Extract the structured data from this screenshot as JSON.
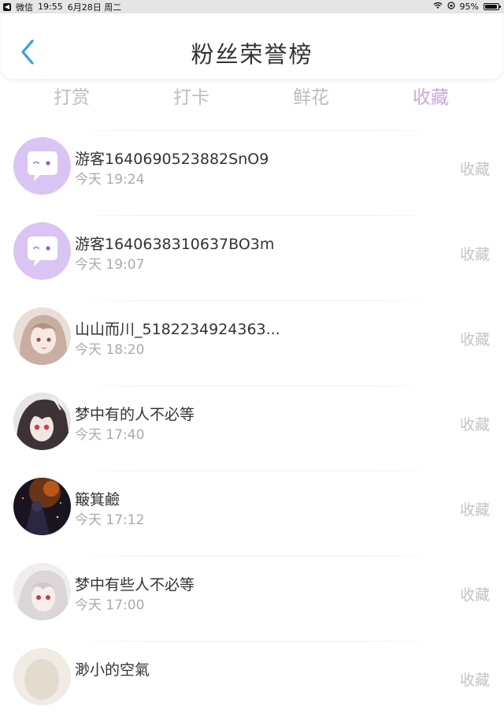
{
  "status_bar": {
    "back_app": "微信",
    "time": "19:55",
    "date": "6月28日 周二",
    "battery": "95%",
    "battery_level": 0.95
  },
  "header": {
    "title": "粉丝荣誉榜"
  },
  "tabs": [
    {
      "label": "打赏",
      "active": false
    },
    {
      "label": "打卡",
      "active": false
    },
    {
      "label": "鲜花",
      "active": false
    },
    {
      "label": "收藏",
      "active": true
    }
  ],
  "colors": {
    "active_tab": "#c8a8e6",
    "back_arrow": "#3a9ee8",
    "bot_avatar": "#d9c4f3"
  },
  "list": [
    {
      "name": "游客1640690523882SnO9",
      "time": "今天 19:24",
      "action": "收藏",
      "avatar": "chat-bubble-icon"
    },
    {
      "name": "游客1640638310637BO3m",
      "time": "今天 19:07",
      "action": "收藏",
      "avatar": "chat-bubble-icon"
    },
    {
      "name": "山山而川_5182234924363...",
      "time": "今天 18:20",
      "action": "收藏",
      "avatar": "user-photo"
    },
    {
      "name": "梦中有的人不必等",
      "time": "今天 17:40",
      "action": "收藏",
      "avatar": "user-photo"
    },
    {
      "name": "簸箕鹼",
      "time": "今天 17:12",
      "action": "收藏",
      "avatar": "user-photo"
    },
    {
      "name": "梦中有些人不必等",
      "time": "今天 17:00",
      "action": "收藏",
      "avatar": "user-photo"
    },
    {
      "name": "渺小的空氣",
      "time": "",
      "action": "收藏",
      "avatar": "user-photo"
    }
  ]
}
